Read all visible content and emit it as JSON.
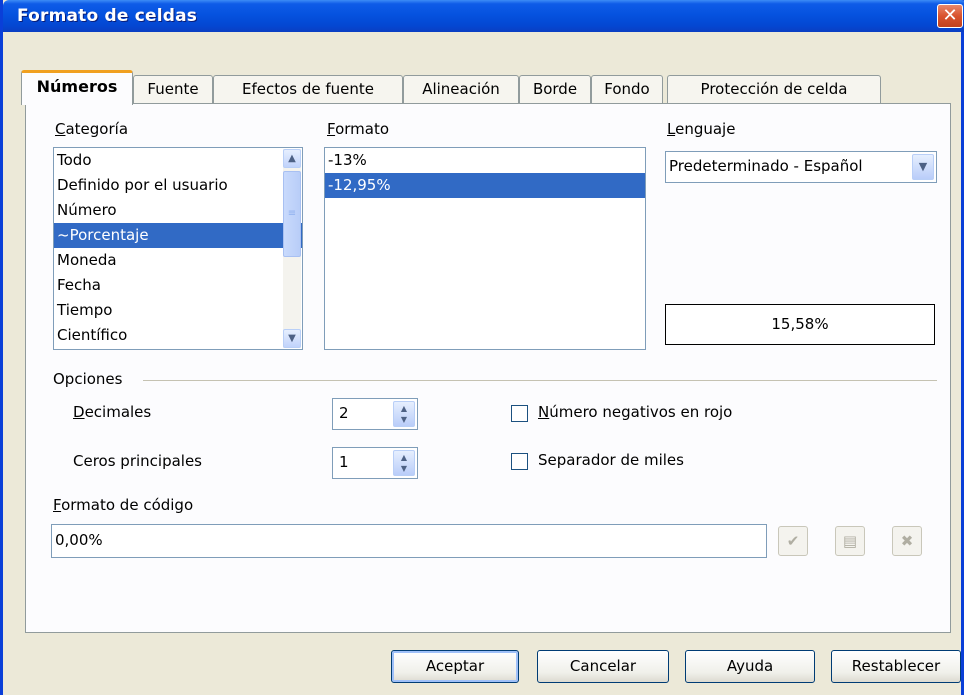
{
  "window": {
    "title": "Formato de celdas"
  },
  "tabs": [
    {
      "label": "Números"
    },
    {
      "label": "Fuente"
    },
    {
      "label": "Efectos de fuente"
    },
    {
      "label": "Alineación"
    },
    {
      "label": "Borde"
    },
    {
      "label": "Fondo"
    },
    {
      "label": "Protección de celda"
    }
  ],
  "category": {
    "label": "Categoría",
    "items": [
      "Todo",
      "Definido por el usuario",
      "Número",
      "~Porcentaje",
      "Moneda",
      "Fecha",
      "Tiempo",
      "Científico"
    ],
    "selected": "~Porcentaje"
  },
  "format": {
    "label": "Formato",
    "items": [
      "-13%",
      "-12,95%"
    ],
    "selected": "-12,95%"
  },
  "language": {
    "label": "Lenguaje",
    "value": "Predeterminado - Español"
  },
  "preview": {
    "value": "15,58%"
  },
  "options": {
    "label": "Opciones",
    "decimals_label": "Decimales",
    "decimals_value": "2",
    "leading_zeros_label": "Ceros principales",
    "leading_zeros_value": "1",
    "negative_red_label": "Número negativos en rojo",
    "negative_red_checked": false,
    "thousands_sep_label": "Separador de miles",
    "thousands_sep_checked": false
  },
  "format_code": {
    "label": "Formato de código",
    "value": "0,00%"
  },
  "buttons": {
    "ok": "Aceptar",
    "cancel": "Cancelar",
    "help": "Ayuda",
    "reset": "Restablecer"
  },
  "colors": {
    "titlebar": "#0552df",
    "selection": "#316ac5",
    "active_tab_accent": "#f0a020"
  }
}
